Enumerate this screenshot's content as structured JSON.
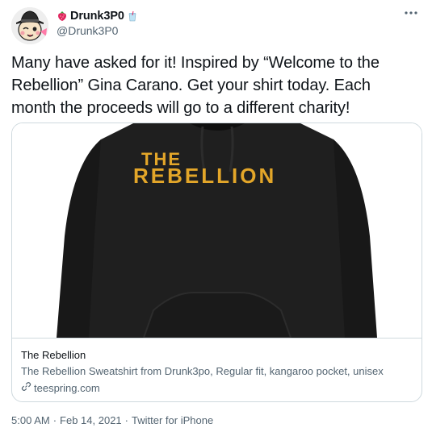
{
  "author": {
    "display_name": "Drunk3P0",
    "handle": "@Drunk3P0",
    "avatar_icon": "cartoon-avatar-with-hat",
    "name_emoji_left": "strawberry-icon",
    "name_emoji_right": "drink-cup-icon"
  },
  "tweet": {
    "text": "Many have asked for it! Inspired by “Welcome to the Rebellion” Gina Carano. Get your shirt today. Each month the proceeds will go to a different charity!"
  },
  "card": {
    "image": {
      "subject": "black hoodie",
      "logo_line1": "THE",
      "logo_line2": "REBELLION",
      "logo_color": "#e3a629"
    },
    "title": "The Rebellion",
    "description": "The Rebellion Sweatshirt from Drunk3po, Regular fit, kangaroo pocket, unisex",
    "domain": "teespring.com",
    "domain_icon": "link-icon"
  },
  "meta": {
    "time": "5:00 AM",
    "separator1": "·",
    "date": "Feb 14, 2021",
    "separator2": "·",
    "source": "Twitter for iPhone"
  },
  "colors": {
    "text_primary": "#0f1419",
    "text_secondary": "#536471",
    "border": "#cfd9de",
    "hoodie": "#1f1f1f"
  }
}
